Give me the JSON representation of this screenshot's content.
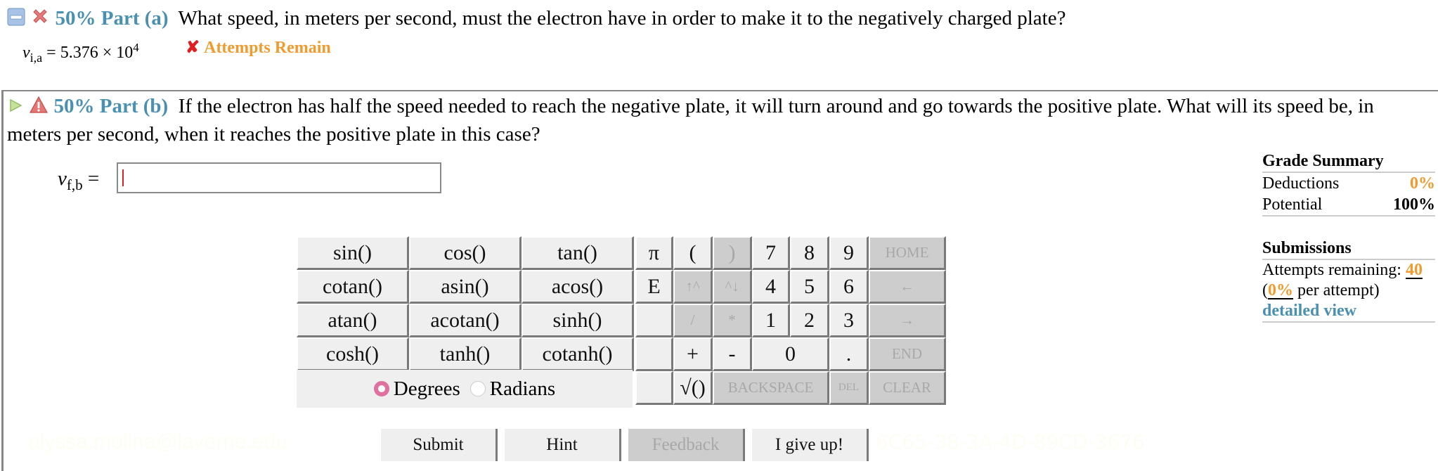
{
  "part_a": {
    "percent": "50%",
    "label": "Part (a)",
    "question": "What speed, in meters per second, must the electron have in order to make it to the negatively charged plate?",
    "answer_var": "v",
    "answer_sub": "i,a",
    "answer_value": "= 5.376 × 10",
    "answer_exp": "4",
    "status_icon": "x-mark-icon",
    "status_text": "Attempts Remain"
  },
  "part_b": {
    "percent": "50%",
    "label": "Part (b)",
    "question": "If the electron has half the speed needed to reach the negative plate, it will turn around and go towards the positive plate. What will its speed be, in meters per second, when it reaches the positive plate in this case?",
    "answer_var": "v",
    "answer_sub": "f,b",
    "answer_eq": "=",
    "answer_value": ""
  },
  "grade_summary": {
    "title": "Grade Summary",
    "deductions_label": "Deductions",
    "deductions_value": "0%",
    "potential_label": "Potential",
    "potential_value": "100%"
  },
  "submissions": {
    "title": "Submissions",
    "attempts_label": "Attempts remaining:",
    "attempts_value": "40",
    "per_attempt_open": "(",
    "per_attempt_value": "0%",
    "per_attempt_label": " per attempt)",
    "detailed_view": "detailed view"
  },
  "keypad": {
    "functions": [
      [
        "sin()",
        "cos()",
        "tan()"
      ],
      [
        "cotan()",
        "asin()",
        "acos()"
      ],
      [
        "atan()",
        "acotan()",
        "sinh()"
      ],
      [
        "cosh()",
        "tanh()",
        "cotanh()"
      ]
    ],
    "angle_modes": {
      "degrees": "Degrees",
      "radians": "Radians",
      "selected": "Degrees"
    },
    "keys": {
      "pi": "π",
      "e": "E",
      "lparen": "(",
      "rparen": ")",
      "up": "↑^",
      "down": "^↓",
      "div": "/",
      "mul": "*",
      "plus": "+",
      "minus": "-",
      "sqrt": "√()",
      "d7": "7",
      "d8": "8",
      "d9": "9",
      "d4": "4",
      "d5": "5",
      "d6": "6",
      "d1": "1",
      "d2": "2",
      "d3": "3",
      "d0": "0",
      "dot": ".",
      "home": "HOME",
      "left": "←",
      "right": "→",
      "end": "END",
      "backspace": "BACKSPACE",
      "del": "DEL",
      "clear": "CLEAR"
    }
  },
  "actions": {
    "submit": "Submit",
    "hint": "Hint",
    "feedback": "Feedback",
    "give_up": "I give up!"
  },
  "watermark": {
    "email": "alyssa.molina@laverne.edu",
    "code": "6C65-38-3A-4D-89CD-3676"
  }
}
